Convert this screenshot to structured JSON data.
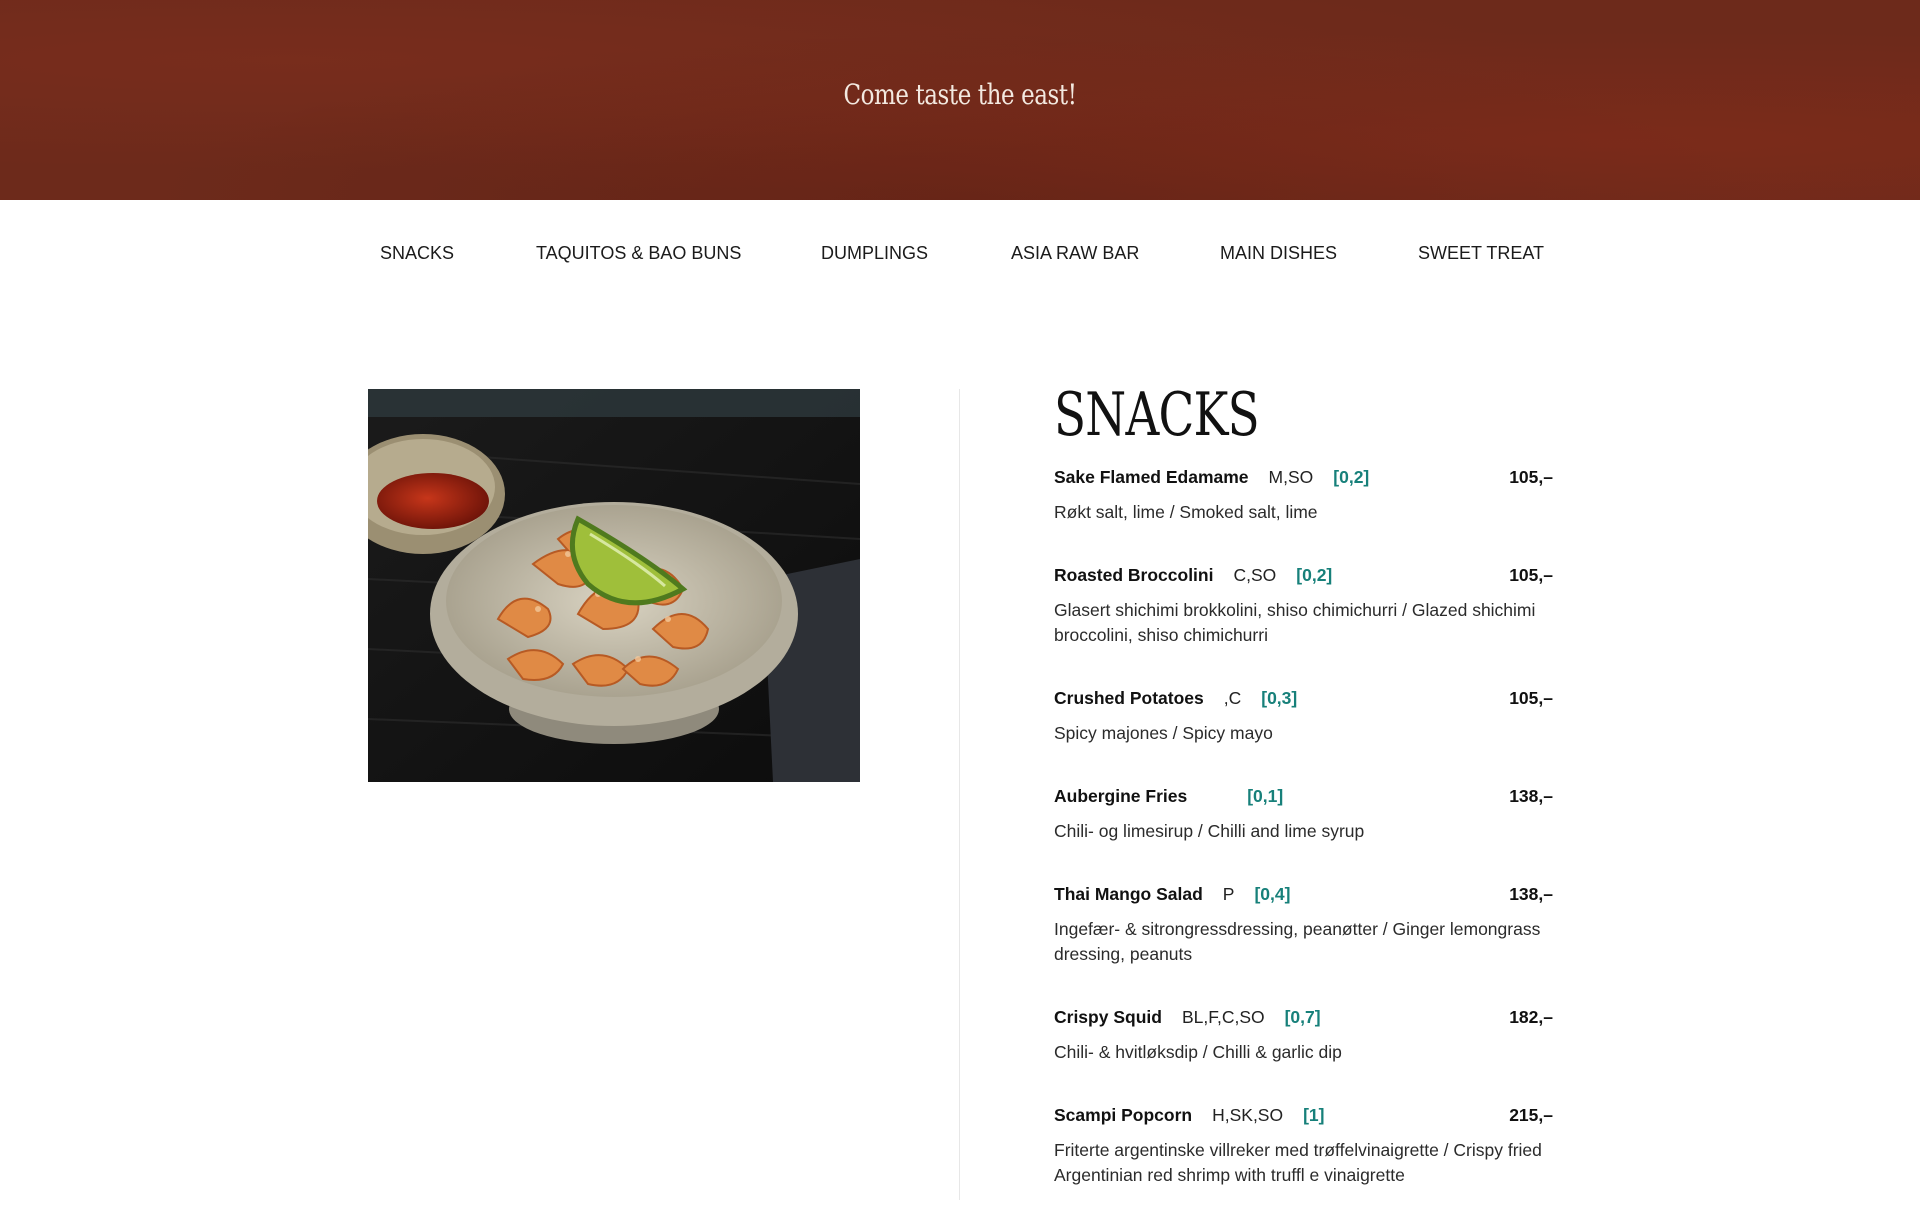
{
  "header": {
    "tagline": "Come taste the east!",
    "background_color": "#6d2a1b"
  },
  "nav": {
    "items": [
      {
        "label": "SNACKS"
      },
      {
        "label": "TAQUITOS & BAO BUNS"
      },
      {
        "label": "DUMPLINGS"
      },
      {
        "label": "ASIA RAW BAR"
      },
      {
        "label": "MAIN DISHES"
      },
      {
        "label": "SWEET TREAT"
      }
    ]
  },
  "section": {
    "title": "SNACKS",
    "image_icon": "food-photo-crispy-snack-bowl-with-lime"
  },
  "menu": {
    "accent_color": "#17807a",
    "items": [
      {
        "name": "Sake Flamed Edamame",
        "allergens": "M,SO",
        "rating": "[0,2]",
        "price": "105,–",
        "description": "Røkt salt, lime / Smoked salt, lime"
      },
      {
        "name": "Roasted Broccolini",
        "allergens": "C,SO",
        "rating": "[0,2]",
        "price": "105,–",
        "description": "Glasert shichimi brokkolini, shiso chimichurri / Glazed shichimi broccolini, shiso chimichurri"
      },
      {
        "name": "Crushed Potatoes",
        "allergens": ",C",
        "rating": "[0,3]",
        "price": "105,–",
        "description": "Spicy majones / Spicy mayo"
      },
      {
        "name": "Aubergine Fries",
        "allergens": "",
        "rating": "[0,1]",
        "price": "138,–",
        "description": "Chili- og limesirup / Chilli and lime syrup"
      },
      {
        "name": "Thai Mango Salad",
        "allergens": "P",
        "rating": "[0,4]",
        "price": "138,–",
        "description": "Ingefær- & sitrongressdressing, peanøtter / Ginger lemongrass dressing, peanuts"
      },
      {
        "name": "Crispy Squid",
        "allergens": "BL,F,C,SO",
        "rating": "[0,7]",
        "price": "182,–",
        "description": "Chili- & hvitløksdip / Chilli & garlic dip"
      },
      {
        "name": "Scampi Popcorn",
        "allergens": "H,SK,SO",
        "rating": "[1]",
        "price": "215,–",
        "description": "Friterte argentinske villreker med trøffelvinaigrette / Crispy fried Argentinian red shrimp with truffl e vinaigrette"
      }
    ]
  }
}
